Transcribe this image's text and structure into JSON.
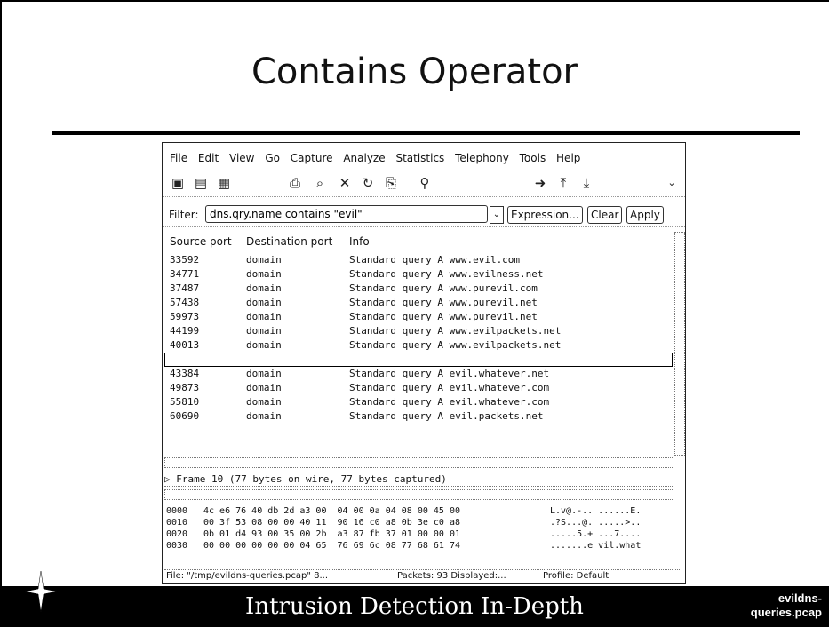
{
  "slide": {
    "title": "Contains Operator",
    "footer": "Intrusion Detection In-Depth",
    "footer_file_line1": "evildns-",
    "footer_file_line2": "queries.pcap"
  },
  "menu": [
    "File",
    "Edit",
    "View",
    "Go",
    "Capture",
    "Analyze",
    "Statistics",
    "Telephony",
    "Tools",
    "Help"
  ],
  "filter": {
    "label": "Filter:",
    "value": "dns.qry.name contains \"evil\"",
    "expression": "Expression...",
    "clear": "Clear",
    "apply": "Apply"
  },
  "columns": [
    "Source port",
    "Destination port",
    "Info"
  ],
  "packets": [
    {
      "src": "33592",
      "dst": "domain",
      "info": "Standard query A www.evil.com"
    },
    {
      "src": "34771",
      "dst": "domain",
      "info": "Standard query A www.evilness.net"
    },
    {
      "src": "37487",
      "dst": "domain",
      "info": "Standard query A www.purevil.com"
    },
    {
      "src": "57438",
      "dst": "domain",
      "info": "Standard query A www.purevil.net"
    },
    {
      "src": "59973",
      "dst": "domain",
      "info": "Standard query A www.purevil.net"
    },
    {
      "src": "44199",
      "dst": "domain",
      "info": "Standard query A www.evilpackets.net"
    },
    {
      "src": "40013",
      "dst": "domain",
      "info": "Standard query A www.evilpackets.net"
    },
    {
      "src": "",
      "dst": "",
      "info": ""
    },
    {
      "src": "43384",
      "dst": "domain",
      "info": "Standard query A evil.whatever.net"
    },
    {
      "src": "49873",
      "dst": "domain",
      "info": "Standard query A evil.whatever.com"
    },
    {
      "src": "55810",
      "dst": "domain",
      "info": "Standard query A evil.whatever.com"
    },
    {
      "src": "60690",
      "dst": "domain",
      "info": "Standard query A evil.packets.net"
    }
  ],
  "detail": "▷ Frame 10 (77 bytes on wire, 77 bytes captured)",
  "hex": [
    {
      "off": "0000",
      "bytes": "4c e6 76 40 db 2d a3 00  04 00 0a 04 08 00 45 00",
      "ascii": "L.v@.-.. ......E."
    },
    {
      "off": "0010",
      "bytes": "00 3f 53 08 00 00 40 11  90 16 c0 a8 0b 3e c0 a8",
      "ascii": ".?S...@. .....>.."
    },
    {
      "off": "0020",
      "bytes": "0b 01 d4 93 00 35 00 2b  a3 87 fb 37 01 00 00 01",
      "ascii": ".....5.+ ...7...."
    },
    {
      "off": "0030",
      "bytes": "00 00 00 00 00 00 04 65  76 69 6c 08 77 68 61 74",
      "ascii": ".......e vil.what"
    }
  ],
  "status": {
    "file": "File: \"/tmp/evildns-queries.pcap\" 8...",
    "packets": "Packets: 93 Displayed:...",
    "profile": "Profile: Default"
  }
}
